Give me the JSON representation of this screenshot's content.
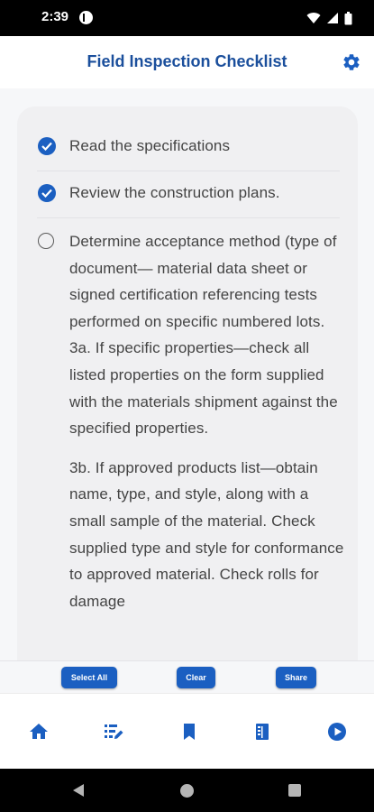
{
  "status": {
    "time": "2:39"
  },
  "header": {
    "title": "Field Inspection Checklist",
    "settings_icon": "gear-icon"
  },
  "checklist": [
    {
      "checked": true,
      "text": "Read the specifications"
    },
    {
      "checked": true,
      "text": "Review the construction plans."
    },
    {
      "checked": false,
      "text": "Determine acceptance method (type of document— material data sheet or signed certification referencing tests performed on specific numbered lots.",
      "sub_a": "3a. If specific properties—check all listed properties on the form supplied with the materials shipment against the specified properties.",
      "sub_b": "3b. If approved products list—obtain name, type, and style, along with a small sample of the material. Check supplied type and style for conformance to approved material. Check rolls for damage"
    }
  ],
  "actions": {
    "select_all": "Select All",
    "clear": "Clear",
    "share": "Share"
  },
  "nav": [
    "home-icon",
    "edit-list-icon",
    "bookmark-icon",
    "document-icon",
    "play-icon"
  ],
  "colors": {
    "accent": "#1b5fc1",
    "title": "#1b4f9c",
    "text": "#444444"
  }
}
